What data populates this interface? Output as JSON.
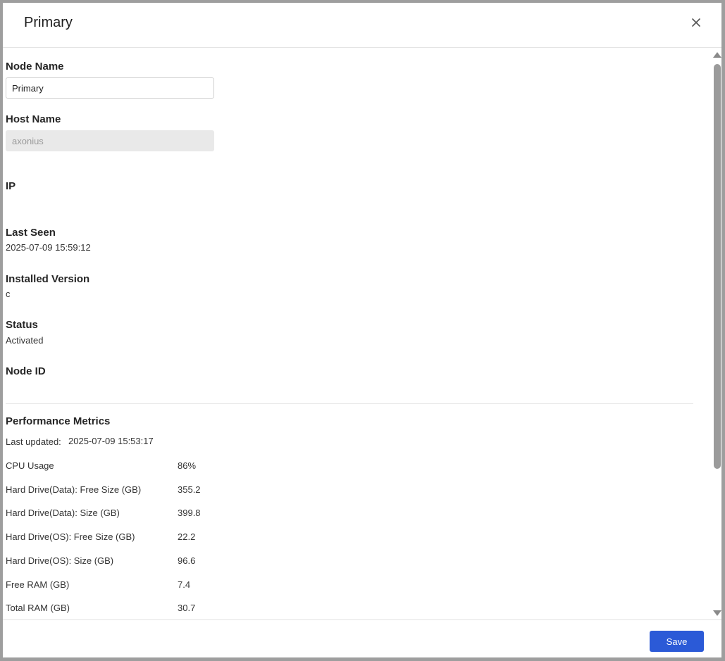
{
  "dialog": {
    "title": "Primary",
    "close_icon": "close-icon"
  },
  "fields": {
    "node_name": {
      "label": "Node Name",
      "value": "Primary"
    },
    "host_name": {
      "label": "Host Name",
      "value": "axonius"
    },
    "ip": {
      "label": "IP",
      "value": ""
    },
    "last_seen": {
      "label": "Last Seen",
      "value": "2025-07-09 15:59:12"
    },
    "installed_version": {
      "label": "Installed Version",
      "value": "c"
    },
    "status": {
      "label": "Status",
      "value": "Activated"
    },
    "node_id": {
      "label": "Node ID",
      "value": ""
    }
  },
  "performance": {
    "title": "Performance Metrics",
    "last_updated_label": "Last updated:",
    "last_updated_value": "2025-07-09 15:53:17",
    "metrics": [
      {
        "name": "CPU Usage",
        "value": "86%"
      },
      {
        "name": "Hard Drive(Data): Free Size (GB)",
        "value": "355.2"
      },
      {
        "name": "Hard Drive(Data): Size (GB)",
        "value": "399.8"
      },
      {
        "name": "Hard Drive(OS): Free Size (GB)",
        "value": "22.2"
      },
      {
        "name": "Hard Drive(OS): Size (GB)",
        "value": "96.6"
      },
      {
        "name": "Free RAM (GB)",
        "value": "7.4"
      },
      {
        "name": "Total RAM (GB)",
        "value": "30.7"
      }
    ]
  },
  "footer": {
    "save_label": "Save"
  },
  "colors": {
    "accent": "#2b5ad7",
    "disabled_bg": "#e9e9e9"
  }
}
